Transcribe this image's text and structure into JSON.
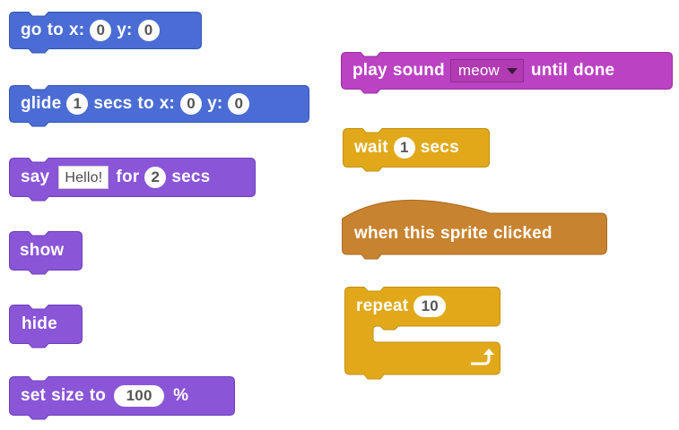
{
  "colors": {
    "motion": "#4a6cd4",
    "looks": "#8a55d7",
    "sound": "#bb42c3",
    "control": "#e1a91a",
    "events": "#c88330"
  },
  "blocks": {
    "go_to": {
      "w1": "go",
      "w2": "to",
      "w3": "x:",
      "x": "0",
      "w4": "y:",
      "y": "0"
    },
    "glide": {
      "w1": "glide",
      "secs": "1",
      "w2": "secs",
      "w3": "to",
      "w4": "x:",
      "x": "0",
      "w5": "y:",
      "y": "0"
    },
    "say": {
      "w1": "say",
      "message": "Hello!",
      "w2": "for",
      "secs": "2",
      "w3": "secs"
    },
    "show": {
      "w1": "show"
    },
    "hide": {
      "w1": "hide"
    },
    "set_size": {
      "w1": "set",
      "w2": "size",
      "w3": "to",
      "value": "100",
      "w4": "%"
    },
    "play_sound": {
      "w1": "play",
      "w2": "sound",
      "sound": "meow",
      "w3": "until",
      "w4": "done"
    },
    "wait": {
      "w1": "wait",
      "secs": "1",
      "w2": "secs"
    },
    "when_clicked": {
      "w1": "when",
      "w2": "this",
      "w3": "sprite",
      "w4": "clicked"
    },
    "repeat": {
      "w1": "repeat",
      "count": "10"
    }
  }
}
